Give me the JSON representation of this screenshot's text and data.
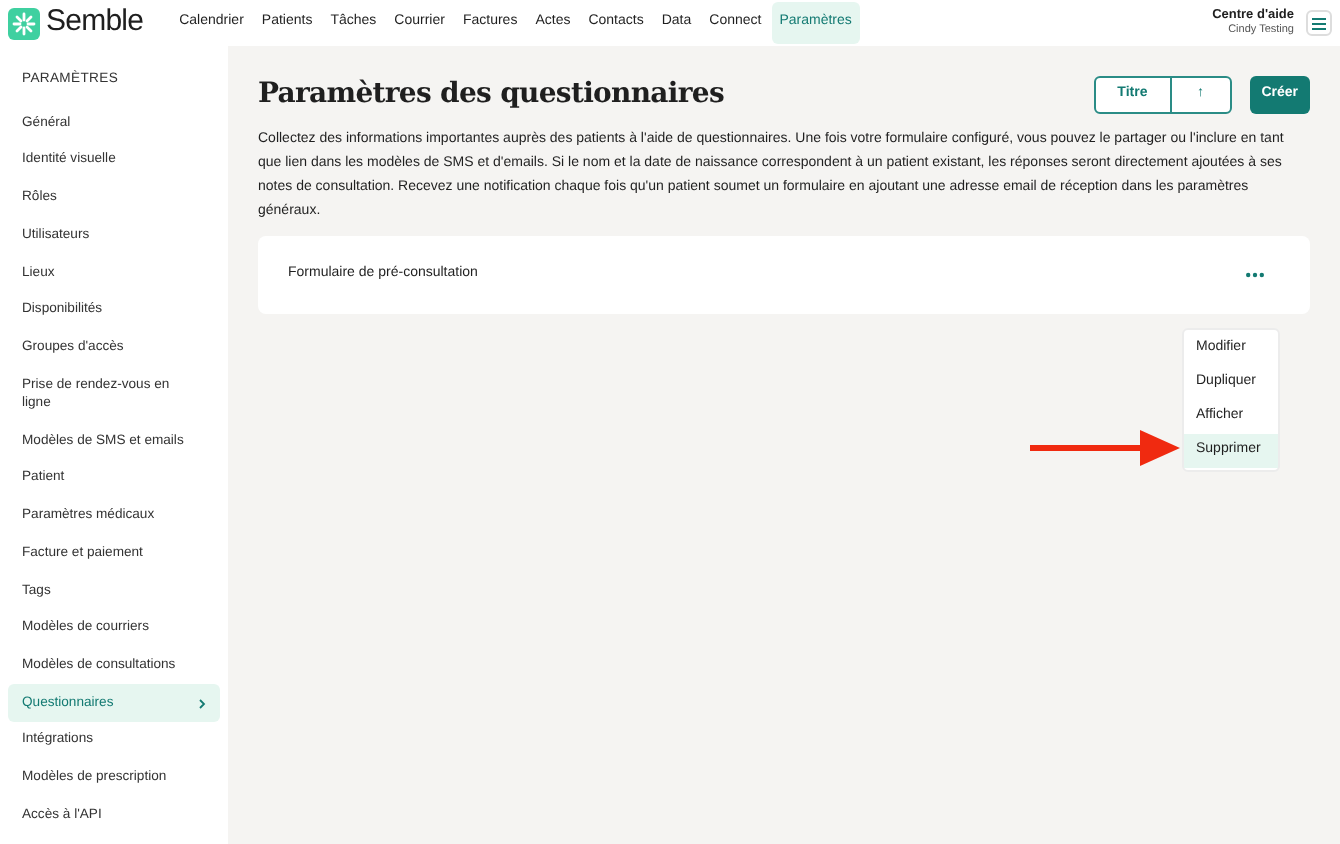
{
  "header": {
    "logo": "Semble",
    "nav": [
      {
        "label": "Calendrier",
        "selected": false
      },
      {
        "label": "Patients",
        "selected": false
      },
      {
        "label": "Tâches",
        "selected": false
      },
      {
        "label": "Courrier",
        "selected": false
      },
      {
        "label": "Factures",
        "selected": false
      },
      {
        "label": "Actes",
        "selected": false
      },
      {
        "label": "Contacts",
        "selected": false
      },
      {
        "label": "Data",
        "selected": false
      },
      {
        "label": "Connect",
        "selected": false
      },
      {
        "label": "Paramètres",
        "selected": true
      }
    ],
    "help": "Centre d'aide",
    "user": "Cindy Testing"
  },
  "sidebar": {
    "heading": "PARAMÈTRES",
    "items": [
      {
        "label": "Général",
        "selected": false
      },
      {
        "label": "Identité visuelle",
        "selected": false
      },
      {
        "label": "Rôles",
        "selected": false
      },
      {
        "label": "Utilisateurs",
        "selected": false
      },
      {
        "label": "Lieux",
        "selected": false
      },
      {
        "label": "Disponibilités",
        "selected": false
      },
      {
        "label": "Groupes d'accès",
        "selected": false
      },
      {
        "label": "Prise de rendez-vous en ligne",
        "selected": false
      },
      {
        "label": "Modèles de SMS et emails",
        "selected": false
      },
      {
        "label": "Patient",
        "selected": false
      },
      {
        "label": "Paramètres médicaux",
        "selected": false
      },
      {
        "label": "Facture et paiement",
        "selected": false
      },
      {
        "label": "Tags",
        "selected": false
      },
      {
        "label": "Modèles de courriers",
        "selected": false
      },
      {
        "label": "Modèles de consultations",
        "selected": false
      },
      {
        "label": "Questionnaires",
        "selected": true
      },
      {
        "label": "Intégrations",
        "selected": false
      },
      {
        "label": "Modèles de prescription",
        "selected": false
      },
      {
        "label": "Accès à l'API",
        "selected": false
      }
    ]
  },
  "main": {
    "title": "Paramètres des questionnaires",
    "sort": {
      "label": "Titre",
      "direction": "↑"
    },
    "create": "Créer",
    "description": "Collectez des informations importantes auprès des patients à l'aide de questionnaires. Une fois votre formulaire configuré, vous pouvez le partager ou l'inclure en tant que lien dans les modèles de SMS et d'emails. Si le nom et la date de naissance correspondent à un patient existant, les réponses seront directement ajoutées à ses notes de consultation. Recevez une notification chaque fois qu'un patient soumet un formulaire en ajoutant une adresse email de réception dans les paramètres généraux.",
    "forms": [
      {
        "name": "Formulaire de pré-consultation"
      }
    ],
    "menu": [
      {
        "label": "Modifier",
        "selected": false
      },
      {
        "label": "Dupliquer",
        "selected": false
      },
      {
        "label": "Afficher",
        "selected": false
      },
      {
        "label": "Supprimer",
        "selected": true
      }
    ]
  }
}
